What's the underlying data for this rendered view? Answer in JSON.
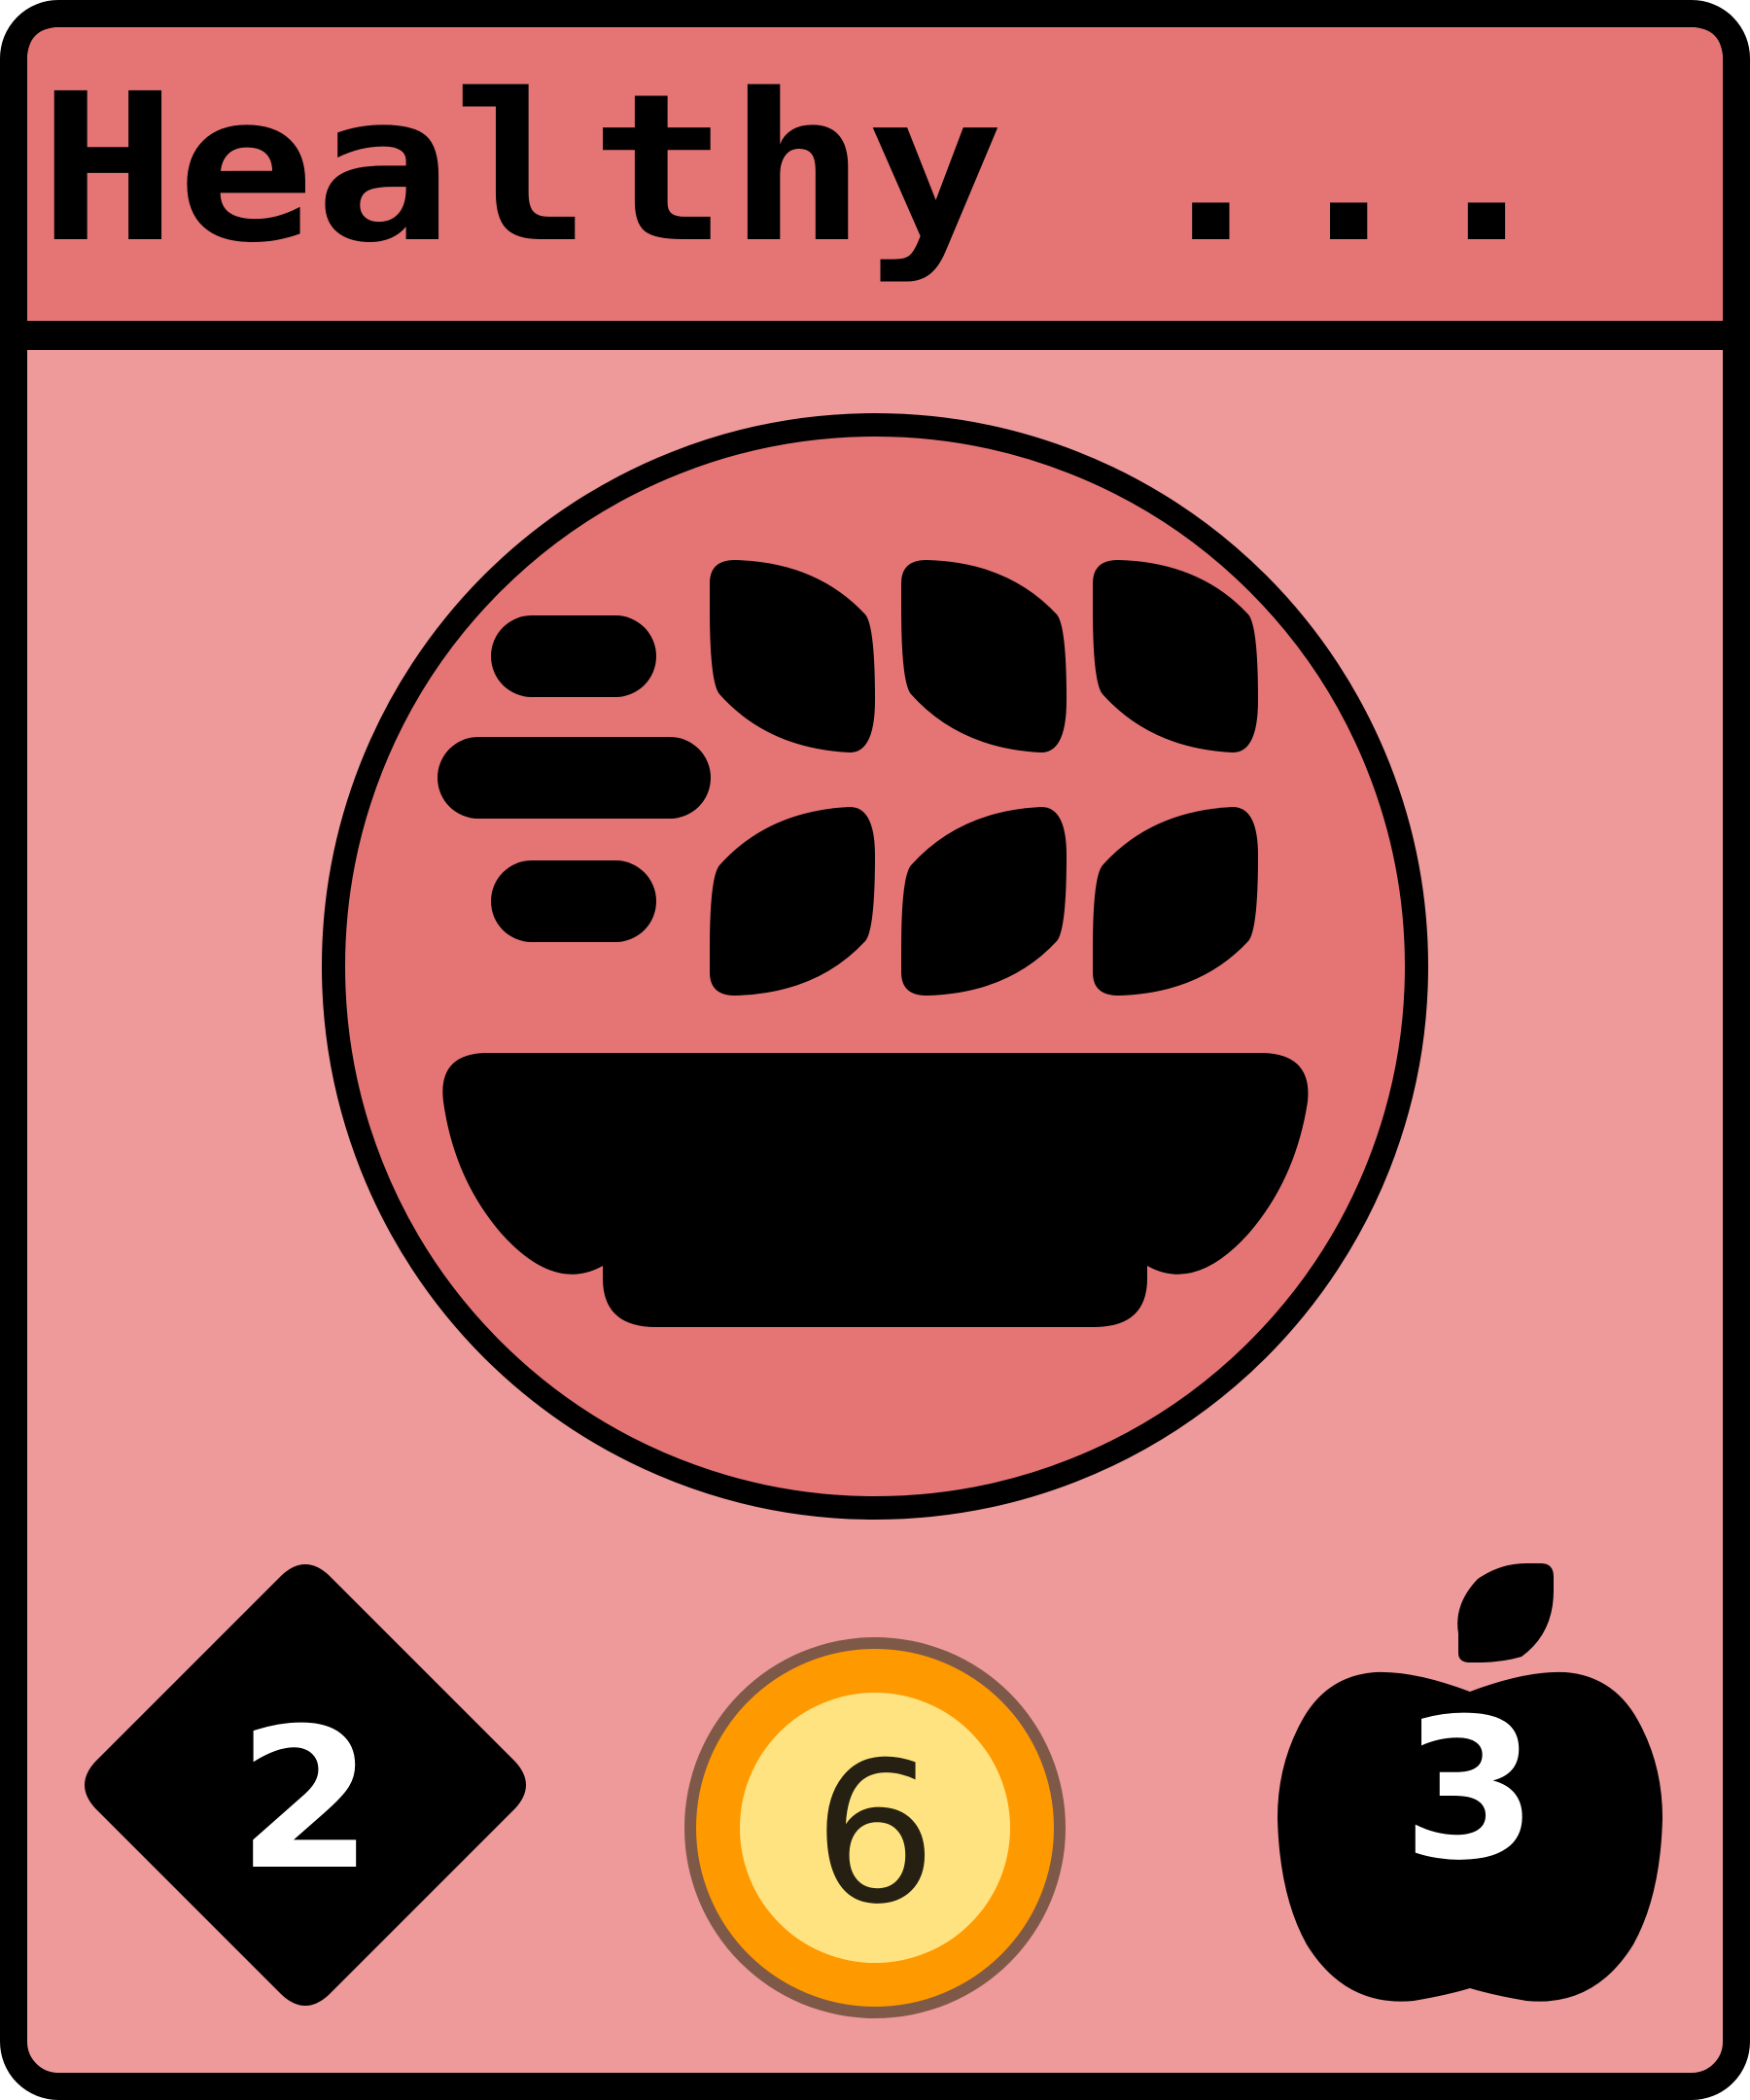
{
  "card": {
    "title": "Healthy ...",
    "icon": "grain-bowl-icon",
    "stats": {
      "cost": {
        "value": "2",
        "icon": "diamond-icon"
      },
      "coins": {
        "value": "6",
        "icon": "coin-icon"
      },
      "food": {
        "value": "3",
        "icon": "apple-icon"
      }
    }
  },
  "colors": {
    "header": "#E57575",
    "body": "#EE999A",
    "circle": "#E57575",
    "outline": "#000000",
    "coin_outer": "#FF9900",
    "coin_inner": "#FFE380",
    "coin_ring": "#7F5947",
    "coin_text": "#252012",
    "stat_text_light": "#FFFFFF"
  }
}
